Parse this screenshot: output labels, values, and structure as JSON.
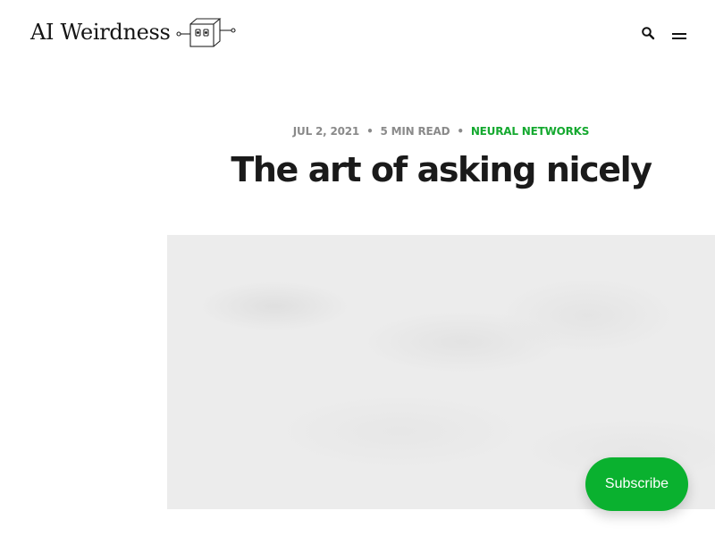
{
  "site": {
    "logo_text": "AI Weirdness",
    "logo_icon": "robot-cube-icon"
  },
  "header": {
    "search_icon": "search-icon",
    "menu_icon": "hamburger-menu-icon"
  },
  "post": {
    "date": "JUL 2, 2021",
    "read_time": "5 MIN READ",
    "separator": "•",
    "tag": "NEURAL NETWORKS",
    "title": "The art of asking nicely"
  },
  "subscribe": {
    "label": "Subscribe"
  },
  "colors": {
    "accent": "#15a930",
    "subscribe_bg": "#0ab12f",
    "title": "#1a1a1a",
    "meta": "#8a8a8a"
  }
}
